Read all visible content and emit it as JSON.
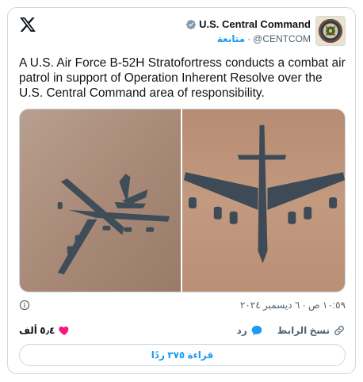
{
  "author": {
    "name": "U.S. Central Command",
    "handle": "@CENTCOM",
    "follow_label": "متابعة",
    "separator": "·"
  },
  "tweet": {
    "text": "A U.S. Air Force B-52H Stratofortress conducts a combat air patrol in support of Operation Inherent Resolve over the U.S. Central Command area of responsibility.",
    "timestamp": "١٠:٥٩ ص · ٦ ديسمبر ٢٠٢٤"
  },
  "actions": {
    "likes_count": "٥٫٤ ألف",
    "reply_label": "رد",
    "copy_link_label": "نسخ الرابط"
  },
  "read_replies_label": "قراءة ٣٧٥ ردًا",
  "colors": {
    "accent": "#1d9bf0",
    "like": "#f91880",
    "sky": "#b79a86",
    "desert": "#b58b6f",
    "aircraft": "#3e4c57"
  },
  "icons": {
    "logo": "x-logo-icon",
    "verified": "verified-badge-icon",
    "info": "info-icon",
    "like": "heart-icon",
    "reply": "reply-bubble-icon",
    "copy": "link-icon"
  }
}
